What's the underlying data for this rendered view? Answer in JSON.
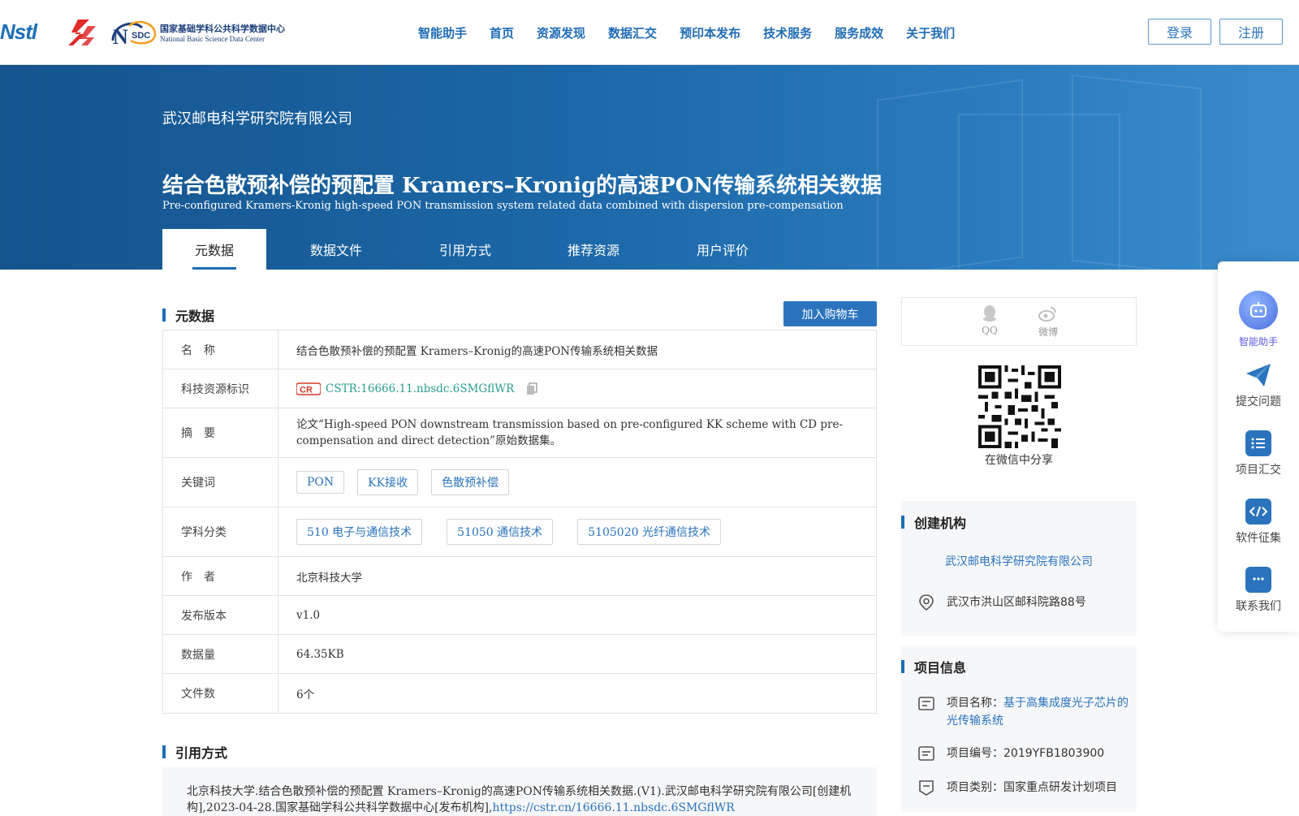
{
  "header": {
    "logo_nstl": "Nstl",
    "logo_nsdc_cn": "国家基础学科公共科学数据中心",
    "logo_nsdc_en": "National Basic Science Data Center",
    "logo_nsdc_mark": "SDC",
    "nav": [
      "智能助手",
      "首页",
      "资源发现",
      "数据汇交",
      "预印本发布",
      "技术服务",
      "服务成效",
      "关于我们"
    ],
    "login": "登录",
    "register": "注册"
  },
  "banner": {
    "org": "武汉邮电科学研究院有限公司",
    "title": "结合色散预补偿的预配置 Kramers–Kronig的高速PON传输系统相关数据",
    "subtitle": "Pre-configured Kramers-Kronig high-speed PON transmission system related data combined with dispersion pre-compensation",
    "tabs": [
      "元数据",
      "数据文件",
      "引用方式",
      "推荐资源",
      "用户评价"
    ]
  },
  "metadata": {
    "heading": "元数据",
    "cart": "加入购物车",
    "rows": {
      "name_label": "名　称",
      "name_value": "结合色散预补偿的预配置 Kramers–Kronig的高速PON传输系统相关数据",
      "id_label": "科技资源标识",
      "id_value": "CSTR:16666.11.nbsdc.6SMGflWR",
      "abstract_label": "摘　要",
      "abstract_value": "论文“High-speed PON downstream transmission based on pre-configured KK scheme with CD pre-compensation and direct detection”原始数据集。",
      "keywords_label": "关键词",
      "keywords": [
        "PON",
        "KK接收",
        "色散预补偿"
      ],
      "subject_label": "学科分类",
      "subjects": [
        "510 电子与通信技术",
        "51050 通信技术",
        "5105020 光纤通信技术"
      ],
      "author_label": "作　者",
      "author_value": "北京科技大学",
      "version_label": "发布版本",
      "version_value": "v1.0",
      "size_label": "数据量",
      "size_value": "64.35KB",
      "files_label": "文件数",
      "files_value": "6个"
    }
  },
  "cite": {
    "heading": "引用方式",
    "text": "北京科技大学.结合色散预补偿的预配置 Kramers–Kronig的高速PON传输系统相关数据.(V1).武汉邮电科学研究院有限公司[创建机构],2023-04-28.国家基础学科公共科学数据中心[发布机构],",
    "link": "https://cstr.cn/16666.11.nbsdc.6SMGflWR"
  },
  "share": {
    "qq": "QQ",
    "weibo": "微博",
    "wechat": "在微信中分享"
  },
  "creator": {
    "heading": "创建机构",
    "org": "武汉邮电科学研究院有限公司",
    "address": "武汉市洪山区邮科院路88号"
  },
  "project": {
    "heading": "项目信息",
    "name_label": "项目名称：",
    "name_value": "基于高集成度光子芯片的光传输系统",
    "code_label": "项目编号：",
    "code_value": "2019YFB1803900",
    "type_label": "项目类别：",
    "type_value": "国家重点研发计划项目"
  },
  "float_bar": {
    "assistant": "智能助手",
    "submit": "提交问题",
    "project": "项目汇交",
    "software": "软件征集",
    "contact": "联系我们"
  },
  "colors": {
    "primary": "#1f6cb5",
    "banner": "#1c68a8",
    "tag_text": "#2a73bd",
    "cstr_link": "#2a9d8f"
  }
}
